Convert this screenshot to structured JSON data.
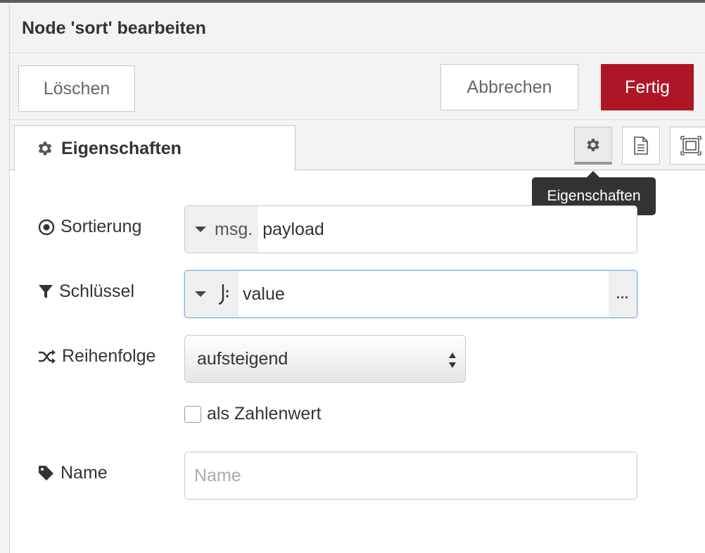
{
  "dialog": {
    "title": "Node 'sort' bearbeiten"
  },
  "toolbar": {
    "delete_label": "Löschen",
    "cancel_label": "Abbrechen",
    "done_label": "Fertig"
  },
  "tabs": {
    "active_label": "Eigenschaften",
    "tooltip": "Eigenschaften",
    "icons": [
      "gear-icon",
      "description-icon",
      "appearance-icon"
    ]
  },
  "form": {
    "sort": {
      "label": "Sortierung",
      "type_prefix": "msg.",
      "value": "payload"
    },
    "key": {
      "label": "Schlüssel",
      "value": "value",
      "expand": "..."
    },
    "order": {
      "label": "Reihenfolge",
      "selected": "aufsteigend"
    },
    "numeric": {
      "label": "als Zahlenwert",
      "checked": false
    },
    "name": {
      "label": "Name",
      "placeholder": "Name",
      "value": ""
    }
  },
  "colors": {
    "accent": "#ad1625",
    "focus": "#86aee0"
  }
}
